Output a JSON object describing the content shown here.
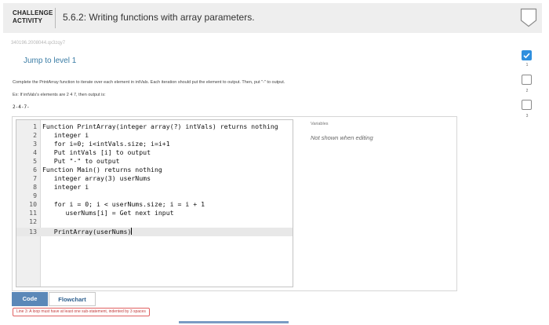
{
  "header": {
    "label_line1": "CHALLENGE",
    "label_line2": "ACTIVITY",
    "title": "5.6.2: Writing functions with array parameters."
  },
  "submission_id": "340196.2008044.qx3zqy7",
  "jump_link": "Jump to level 1",
  "instructions": "Complete the PrintArray function to iterate over each element in intVals. Each iteration should put the element to output. Then, put \"-\" to output.",
  "example": "Ex: If intVals's elements are 2 4 7, then output is:",
  "expected_output": "2-4-7-",
  "levels": [
    {
      "num": "1",
      "status": "complete"
    },
    {
      "num": "2",
      "status": "incomplete"
    },
    {
      "num": "3",
      "status": "incomplete"
    }
  ],
  "code_lines": [
    {
      "num": "1",
      "text": "Function PrintArray(integer array(?) intVals) returns nothing"
    },
    {
      "num": "2",
      "text": "   integer i"
    },
    {
      "num": "3",
      "text": "   for i=0; i<intVals.size; i=i+1"
    },
    {
      "num": "4",
      "text": "   Put intVals [i] to output"
    },
    {
      "num": "5",
      "text": "   Put \"-\" to output"
    },
    {
      "num": "6",
      "text": "Function Main() returns nothing"
    },
    {
      "num": "7",
      "text": "   integer array(3) userNums"
    },
    {
      "num": "8",
      "text": "   integer i"
    },
    {
      "num": "9",
      "text": ""
    },
    {
      "num": "10",
      "text": "   for i = 0; i < userNums.size; i = i + 1"
    },
    {
      "num": "11",
      "text": "      userNums[i] = Get next input"
    },
    {
      "num": "12",
      "text": ""
    },
    {
      "num": "13",
      "text": "   PrintArray(userNums)"
    }
  ],
  "variables": {
    "title": "Variables",
    "note": "Not shown when editing"
  },
  "tabs": {
    "code": "Code",
    "flowchart": "Flowchart"
  },
  "error_message": "Line 3: A loop must have at least one sub-statement, indented by 3 spaces",
  "colors": {
    "accent": "#5b88b8",
    "level_complete": "#2f8fde",
    "error": "#c23b3b"
  }
}
